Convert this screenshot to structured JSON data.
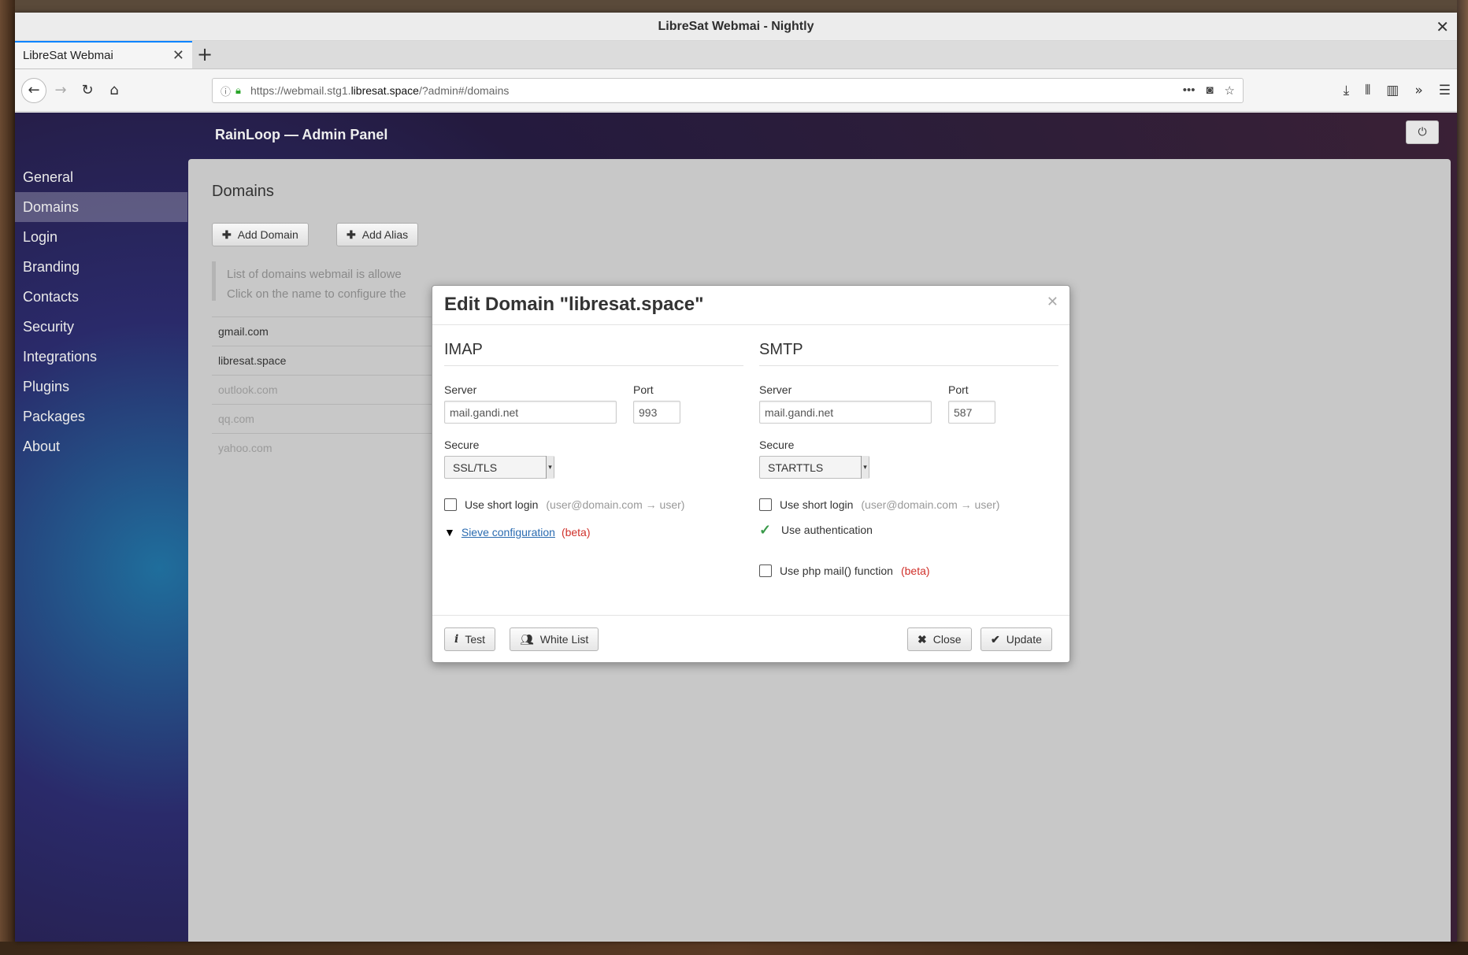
{
  "browser": {
    "window_title": "LibreSat Webmai - Nightly",
    "tab_title": "LibreSat Webmai",
    "url_prefix": "https://webmail.stg1.",
    "url_host": "libresat.space",
    "url_suffix": "/?admin#/domains"
  },
  "app": {
    "title": "RainLoop — Admin Panel"
  },
  "sidebar": {
    "items": [
      {
        "label": "General"
      },
      {
        "label": "Domains",
        "active": true
      },
      {
        "label": "Login"
      },
      {
        "label": "Branding"
      },
      {
        "label": "Contacts"
      },
      {
        "label": "Security"
      },
      {
        "label": "Integrations"
      },
      {
        "label": "Plugins"
      },
      {
        "label": "Packages"
      },
      {
        "label": "About"
      }
    ]
  },
  "domains_page": {
    "heading": "Domains",
    "add_domain_label": "Add Domain",
    "add_alias_label": "Add Alias",
    "note_line1": "List of domains webmail is allowe",
    "note_line2": "Click on the name to configure the",
    "domains": [
      {
        "name": "gmail.com",
        "enabled": true
      },
      {
        "name": "libresat.space",
        "enabled": true
      },
      {
        "name": "outlook.com",
        "enabled": false
      },
      {
        "name": "qq.com",
        "enabled": false
      },
      {
        "name": "yahoo.com",
        "enabled": false
      }
    ]
  },
  "modal": {
    "title": "Edit Domain \"libresat.space\"",
    "imap": {
      "section": "IMAP",
      "server_label": "Server",
      "server_value": "mail.gandi.net",
      "port_label": "Port",
      "port_value": "993",
      "secure_label": "Secure",
      "secure_value": "SSL/TLS",
      "short_login_label": "Use short login",
      "short_login_hint": "(user@domain.com → user)",
      "short_login_checked": false,
      "sieve_label": "Sieve configuration",
      "sieve_beta": "(beta)"
    },
    "smtp": {
      "section": "SMTP",
      "server_label": "Server",
      "server_value": "mail.gandi.net",
      "port_label": "Port",
      "port_value": "587",
      "secure_label": "Secure",
      "secure_value": "STARTTLS",
      "short_login_label": "Use short login",
      "short_login_hint": "(user@domain.com → user)",
      "short_login_checked": false,
      "auth_label": "Use authentication",
      "auth_checked": true,
      "php_mail_label": "Use php mail() function",
      "php_mail_beta": "(beta)",
      "php_mail_checked": false
    },
    "footer": {
      "test_label": "Test",
      "whitelist_label": "White List",
      "close_label": "Close",
      "update_label": "Update"
    }
  },
  "colors": {
    "accent_tab": "#0a84ff",
    "beta_red": "#d0302a",
    "link_blue": "#2a6bb0",
    "check_green": "#3a9a4a"
  }
}
